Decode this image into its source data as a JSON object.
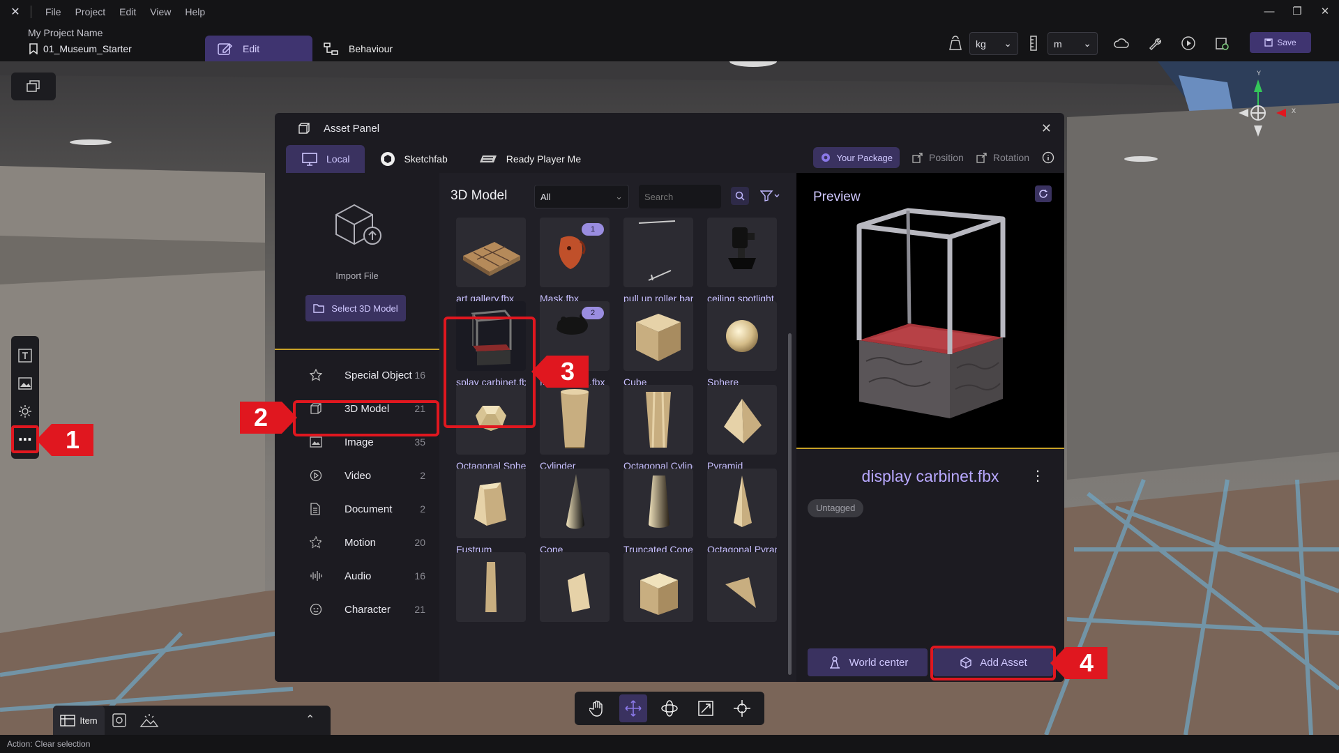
{
  "menubar": {
    "items": [
      "File",
      "Project",
      "Edit",
      "View",
      "Help"
    ]
  },
  "toolbar": {
    "project_name": "My Project Name",
    "scene_name": "01_Museum_Starter",
    "tab_edit": "Edit",
    "tab_behaviour": "Behaviour",
    "mass_unit": "kg",
    "length_unit": "m",
    "save_label": "Save"
  },
  "gizmo": {
    "y_label": "Y",
    "x_label": "X"
  },
  "asset_panel": {
    "title": "Asset Panel",
    "tabs": [
      {
        "label": "Local"
      },
      {
        "label": "Sketchfab"
      },
      {
        "label": "Ready Player Me"
      }
    ],
    "your_package": "Your Package",
    "position": "Position",
    "rotation": "Rotation",
    "import_label": "Import File",
    "select_model": "Select 3D Model",
    "categories": [
      {
        "label": "Special Object",
        "count": "16"
      },
      {
        "label": "3D Model",
        "count": "21"
      },
      {
        "label": "Image",
        "count": "35"
      },
      {
        "label": "Video",
        "count": "2"
      },
      {
        "label": "Document",
        "count": "2"
      },
      {
        "label": "Motion",
        "count": "20"
      },
      {
        "label": "Audio",
        "count": "16"
      },
      {
        "label": "Character",
        "count": "21"
      }
    ],
    "grid_title": "3D Model",
    "filter_value": "All",
    "search_placeholder": "Search",
    "items": [
      {
        "name": "art gallery.fbx"
      },
      {
        "name": "Mask.fbx",
        "badge": "1"
      },
      {
        "name": "pull up roller bar"
      },
      {
        "name": "ceiling spotlight"
      },
      {
        "name": "splay carbinet.fbx"
      },
      {
        "name": "food vessel.fbx",
        "badge": "2"
      },
      {
        "name": "Cube"
      },
      {
        "name": "Sphere"
      },
      {
        "name": "Octagonal Sphere"
      },
      {
        "name": "Cylinder"
      },
      {
        "name": "Octagonal Cylinder"
      },
      {
        "name": "Pyramid"
      },
      {
        "name": "Fustrum"
      },
      {
        "name": "Cone"
      },
      {
        "name": "Truncated Cone"
      },
      {
        "name": "Octagonal Pyramid"
      }
    ],
    "preview_title": "Preview",
    "asset_name": "display carbinet.fbx",
    "tag": "Untagged",
    "world_center": "World center",
    "add_asset": "Add Asset"
  },
  "callouts": [
    "1",
    "2",
    "3",
    "4"
  ],
  "bottom": {
    "item_tab": "Item"
  },
  "status": "Action: Clear selection",
  "colors": {
    "accent": "#3a3260",
    "accent_text": "#d0c8ff",
    "highlight": "#e0171f",
    "divider": "#c9a227"
  }
}
